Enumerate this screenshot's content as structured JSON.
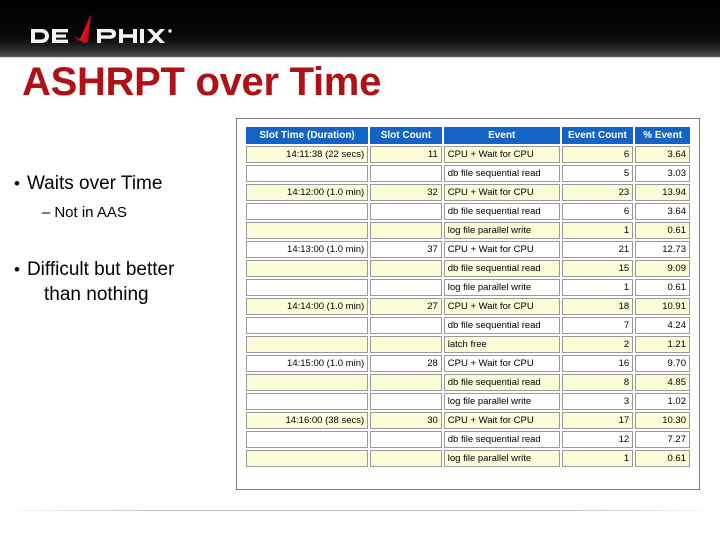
{
  "brand": {
    "logo_text": "DELPHIX",
    "logo_name": "delphix-logo",
    "trademark": "®"
  },
  "title": "ASHRPT over Time",
  "bullets": {
    "item1": "Waits over Time",
    "item1_sub": "Not in AAS",
    "item2": "Difficult but better",
    "item2_cont": "than nothing",
    "bullet_glyph": "•",
    "dash_glyph": "–"
  },
  "colors": {
    "title_red": "#B01116",
    "header_blue": "#1364C4",
    "row_yellow": "#FCFCD8",
    "banner_black": "#000000"
  },
  "report": {
    "columns": [
      "Slot Time (Duration)",
      "Slot Count",
      "Event",
      "Event Count",
      "% Event"
    ],
    "rows": [
      {
        "slot_time": "14:11:38 (22 secs)",
        "slot_count": "11",
        "event": "CPU + Wait for CPU",
        "event_count": "6",
        "pct_event": "3.64"
      },
      {
        "slot_time": "",
        "slot_count": "",
        "event": "db file sequential read",
        "event_count": "5",
        "pct_event": "3.03"
      },
      {
        "slot_time": "14:12:00 (1.0 min)",
        "slot_count": "32",
        "event": "CPU + Wait for CPU",
        "event_count": "23",
        "pct_event": "13.94"
      },
      {
        "slot_time": "",
        "slot_count": "",
        "event": "db file sequential read",
        "event_count": "6",
        "pct_event": "3.64"
      },
      {
        "slot_time": "",
        "slot_count": "",
        "event": "log file parallel write",
        "event_count": "1",
        "pct_event": "0.61"
      },
      {
        "slot_time": "14:13:00 (1.0 min)",
        "slot_count": "37",
        "event": "CPU + Wait for CPU",
        "event_count": "21",
        "pct_event": "12.73"
      },
      {
        "slot_time": "",
        "slot_count": "",
        "event": "db file sequential read",
        "event_count": "15",
        "pct_event": "9.09"
      },
      {
        "slot_time": "",
        "slot_count": "",
        "event": "log file parallel write",
        "event_count": "1",
        "pct_event": "0.61"
      },
      {
        "slot_time": "14:14:00 (1.0 min)",
        "slot_count": "27",
        "event": "CPU + Wait for CPU",
        "event_count": "18",
        "pct_event": "10.91"
      },
      {
        "slot_time": "",
        "slot_count": "",
        "event": "db file sequential read",
        "event_count": "7",
        "pct_event": "4.24"
      },
      {
        "slot_time": "",
        "slot_count": "",
        "event": "latch free",
        "event_count": "2",
        "pct_event": "1.21"
      },
      {
        "slot_time": "14:15:00 (1.0 min)",
        "slot_count": "28",
        "event": "CPU + Wait for CPU",
        "event_count": "16",
        "pct_event": "9.70"
      },
      {
        "slot_time": "",
        "slot_count": "",
        "event": "db file sequential read",
        "event_count": "8",
        "pct_event": "4.85"
      },
      {
        "slot_time": "",
        "slot_count": "",
        "event": "log file parallel write",
        "event_count": "3",
        "pct_event": "1.02"
      },
      {
        "slot_time": "14:16:00 (38 secs)",
        "slot_count": "30",
        "event": "CPU + Wait for CPU",
        "event_count": "17",
        "pct_event": "10.30"
      },
      {
        "slot_time": "",
        "slot_count": "",
        "event": "db file sequential read",
        "event_count": "12",
        "pct_event": "7.27"
      },
      {
        "slot_time": "",
        "slot_count": "",
        "event": "log file parallel write",
        "event_count": "1",
        "pct_event": "0.61"
      }
    ]
  }
}
